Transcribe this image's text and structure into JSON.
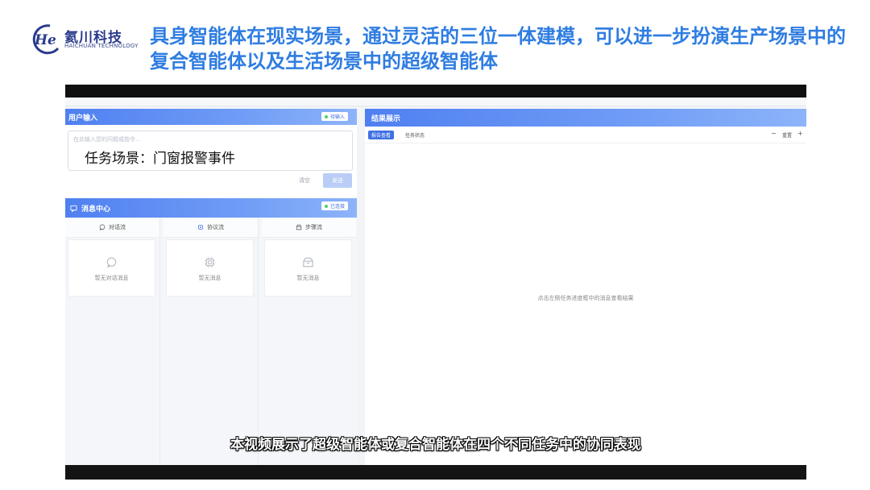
{
  "logo": {
    "text_cn": "氦川科技",
    "text_en": "HAICHUAN TECHNOLOGY",
    "mark": "He"
  },
  "slide": {
    "title": "具身智能体在现实场景，通过灵活的三位一体建模，可以进一步扮演生产场景中的复合智能体以及生活场景中的超级智能体"
  },
  "user_input": {
    "title": "用户输入",
    "badge": "待输入",
    "placeholder": "在此输入您的问题或指令...",
    "task_text": "任务场景：门窗报警事件",
    "clear_label": "清空",
    "send_label": "发送"
  },
  "message_center": {
    "title": "消息中心",
    "status_badge": "已连接",
    "columns": [
      {
        "label": "对话流",
        "empty": "暂无对话消息",
        "icon": "chat-bubble-icon"
      },
      {
        "label": "协议流",
        "empty": "暂无消息",
        "icon": "chip-icon"
      },
      {
        "label": "步骤流",
        "empty": "暂无消息",
        "icon": "box-icon"
      }
    ]
  },
  "result": {
    "title": "结果展示",
    "tabs": [
      "报告查看",
      "任务状态"
    ],
    "zoom_minus": "−",
    "zoom_label": "重置",
    "zoom_plus": "+",
    "hint": "点击左侧任务进度框中的消息查看结果"
  },
  "subtitle": "本视频展示了超级智能体或复合智能体在四个不同任务中的协同表现",
  "colors": {
    "title_blue": "#2f7de1",
    "panel_blue": "#4f80f0",
    "logo_navy": "#2a3a8c",
    "status_green": "#4ccf6c"
  }
}
